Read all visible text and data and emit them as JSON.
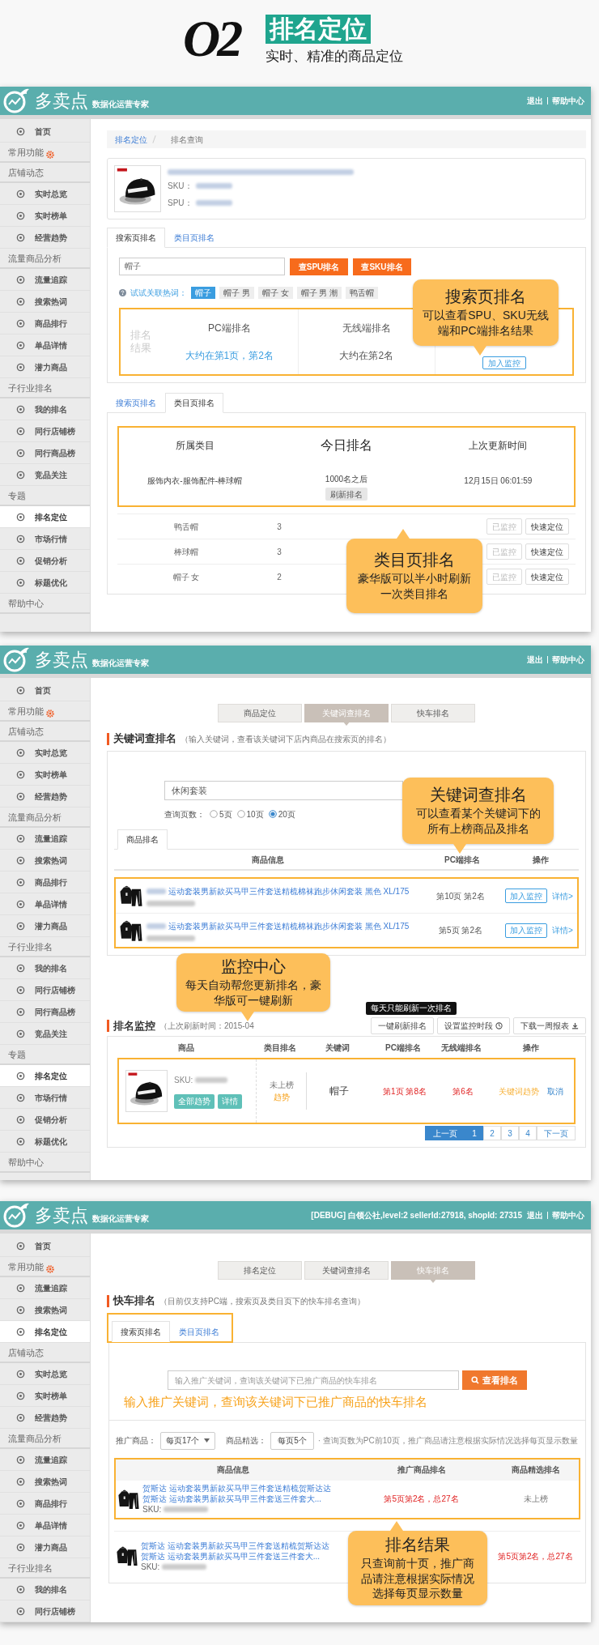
{
  "banner": {
    "number": "O2",
    "title": "排名定位",
    "subtitle": "实时、精准的商品定位"
  },
  "search_ranking_screen": {
    "topbar": {
      "brand": "多卖点",
      "tagline": "数据化运营专家",
      "links": [
        "退出",
        "帮助中心"
      ]
    },
    "sidebar": [
      {
        "kind": "item",
        "label": "首页",
        "selected": false
      },
      {
        "kind": "section",
        "label": "常用功能",
        "gear": true
      },
      {
        "kind": "section",
        "label": "店铺动态"
      },
      {
        "kind": "item",
        "label": "实时总览",
        "selected": false
      },
      {
        "kind": "item",
        "label": "实时榜单",
        "selected": false
      },
      {
        "kind": "item",
        "label": "经营趋势",
        "selected": false
      },
      {
        "kind": "section",
        "label": "流量商品分析"
      },
      {
        "kind": "item",
        "label": "流量追踪",
        "selected": false
      },
      {
        "kind": "item",
        "label": "搜索热词",
        "selected": false
      },
      {
        "kind": "item",
        "label": "商品排行",
        "selected": false
      },
      {
        "kind": "item",
        "label": "单品详情",
        "selected": false
      },
      {
        "kind": "item",
        "label": "潜力商品",
        "selected": false
      },
      {
        "kind": "section",
        "label": "子行业排名"
      },
      {
        "kind": "item",
        "label": "我的排名",
        "selected": false
      },
      {
        "kind": "item",
        "label": "同行店铺榜",
        "selected": false
      },
      {
        "kind": "item",
        "label": "同行商品榜",
        "selected": false
      },
      {
        "kind": "item",
        "label": "竞品关注",
        "selected": false
      },
      {
        "kind": "section",
        "label": "专题"
      },
      {
        "kind": "item",
        "label": "排名定位",
        "selected": true
      },
      {
        "kind": "item",
        "label": "市场行情",
        "selected": false
      },
      {
        "kind": "item",
        "label": "促销分析",
        "selected": false
      },
      {
        "kind": "item",
        "label": "标题优化",
        "selected": false
      },
      {
        "kind": "section",
        "label": "帮助中心"
      }
    ],
    "breadcrumb": [
      "排名定位",
      "排名查询"
    ],
    "product": {
      "sku_label": "SKU：",
      "spu_label": "SPU："
    },
    "tabs": [
      {
        "label": "搜索页排名",
        "selected": true
      },
      {
        "label": "类目页排名",
        "selected": false
      }
    ],
    "search": {
      "value": "帽子",
      "buttons": [
        "查SPU排名",
        "查SKU排名"
      ]
    },
    "hot_words": {
      "label": "试试关联热词：",
      "words": [
        {
          "label": "帽子",
          "selected": true
        },
        {
          "label": "帽子 男",
          "selected": false
        },
        {
          "label": "帽子 女",
          "selected": false
        },
        {
          "label": "帽子 男 潮",
          "selected": false
        },
        {
          "label": "鸭舌帽",
          "selected": false
        }
      ]
    },
    "result": {
      "side_label": "排名结果",
      "columns": [
        {
          "header": "PC端排名",
          "value": "大约在第1页，第2名"
        },
        {
          "header": "无线端排名",
          "value": "大约在第2名"
        }
      ],
      "button": "加入监控"
    },
    "callout": {
      "title": "搜索页排名",
      "text": "可以查看SPU、SKU无线端和PC端排名结果"
    },
    "category_tabs": [
      {
        "label": "搜索页排名",
        "selected": false
      },
      {
        "label": "类目页排名",
        "selected": true
      }
    ],
    "category": {
      "headers": [
        "所属类目",
        "今日排名",
        "上次更新时间"
      ],
      "category": "服饰内衣-服饰配件-棒球帽",
      "rank": "1000名之后",
      "refresh_button": "刷新排名",
      "updated": "12月15日 06:01:59"
    },
    "rows": [
      {
        "cells": [
          "鸭舌帽",
          "3"
        ],
        "buttons": [
          {
            "label": "已监控",
            "disabled": true
          },
          {
            "label": "快速定位",
            "disabled": false
          }
        ]
      },
      {
        "cells": [
          "棒球帽",
          "3"
        ],
        "buttons": [
          {
            "label": "已监控",
            "disabled": true
          },
          {
            "label": "快速定位",
            "disabled": false
          }
        ]
      },
      {
        "cells": [
          "帽子 女",
          "2"
        ],
        "buttons": [
          {
            "label": "已监控",
            "disabled": true
          },
          {
            "label": "快速定位",
            "disabled": false
          }
        ]
      }
    ],
    "callout_2": {
      "title": "类目页排名",
      "text": "豪华版可以半小时刷新一次类目排名"
    }
  },
  "keyword_ranking_screen": {
    "topbar": {
      "brand": "多卖点",
      "tagline": "数据化运营专家",
      "links": [
        "退出",
        "帮助中心"
      ]
    },
    "sidebar": [
      {
        "kind": "item",
        "label": "首页",
        "selected": false
      },
      {
        "kind": "section",
        "label": "常用功能",
        "gear": true
      },
      {
        "kind": "section",
        "label": "店铺动态"
      },
      {
        "kind": "item",
        "label": "实时总览",
        "selected": false
      },
      {
        "kind": "item",
        "label": "实时榜单",
        "selected": false
      },
      {
        "kind": "item",
        "label": "经营趋势",
        "selected": false
      },
      {
        "kind": "section",
        "label": "流量商品分析"
      },
      {
        "kind": "item",
        "label": "流量追踪",
        "selected": false
      },
      {
        "kind": "item",
        "label": "搜索热词",
        "selected": false
      },
      {
        "kind": "item",
        "label": "商品排行",
        "selected": false
      },
      {
        "kind": "item",
        "label": "单品详情",
        "selected": false
      },
      {
        "kind": "item",
        "label": "潜力商品",
        "selected": false
      },
      {
        "kind": "section",
        "label": "子行业排名"
      },
      {
        "kind": "item",
        "label": "我的排名",
        "selected": false
      },
      {
        "kind": "item",
        "label": "同行店铺榜",
        "selected": false
      },
      {
        "kind": "item",
        "label": "同行商品榜",
        "selected": false
      },
      {
        "kind": "item",
        "label": "竞品关注",
        "selected": false
      },
      {
        "kind": "section",
        "label": "专题"
      },
      {
        "kind": "item",
        "label": "排名定位",
        "selected": true
      },
      {
        "kind": "item",
        "label": "市场行情",
        "selected": false
      },
      {
        "kind": "item",
        "label": "促销分析",
        "selected": false
      },
      {
        "kind": "item",
        "label": "标题优化",
        "selected": false
      },
      {
        "kind": "section",
        "label": "帮助中心"
      }
    ],
    "tabs": [
      {
        "label": "商品定位",
        "selected": false
      },
      {
        "label": "关键词查排名",
        "selected": true
      },
      {
        "label": "快车排名",
        "selected": false
      }
    ],
    "section_title": "关键词查排名",
    "section_note": "（输入关键词，查看该关键词下店内商品在搜索页的排名）",
    "search": {
      "value": "休闲套装"
    },
    "pages": {
      "label": "查询页数：",
      "options": [
        {
          "label": "5页",
          "selected": false
        },
        {
          "label": "10页",
          "selected": false
        },
        {
          "label": "20页",
          "selected": true
        }
      ]
    },
    "result_tabs": [
      {
        "label": "商品排名",
        "selected": true
      }
    ],
    "table": {
      "columns": [
        "商品信息",
        "PC端排名",
        "操作"
      ],
      "rows": [
        {
          "title": "运动套装男新款买马甲三件套送精梳棉袜跑步休闲套装 黑色 XL/175",
          "pc_rank": "第10页 第2名",
          "buttons": [
            "加入监控",
            "详情>"
          ]
        },
        {
          "title": "运动套装男新款买马甲三件套送精梳棉袜跑步休闲套装 黑色 XL/175",
          "pc_rank": "第5页 第2名",
          "buttons": [
            "加入监控",
            "详情>"
          ]
        }
      ]
    },
    "callout": {
      "title": "关键词查排名",
      "text": "可以查看某个关键词下的所有上榜商品及排名"
    },
    "monitor": {
      "title": "排名监控",
      "note": "（上次刷新时间：2015-04",
      "tooltip": "每天只能刷新一次排名",
      "buttons": [
        "一键刷新排名",
        "设置监控时段",
        "下载一周报表"
      ],
      "columns": [
        "商品",
        "类目排名",
        "关键词",
        "PC端排名",
        "无线端排名",
        "操作"
      ],
      "row": {
        "sku_label": "SKU:",
        "buttons": [
          "全部趋势",
          "详情"
        ],
        "category_rank": "未上榜",
        "category_trend": "趋势",
        "keyword": "帽子",
        "pc_rank": "第1页 第8名",
        "mobile_rank": "第6名",
        "trend_link": "关键词趋势",
        "cancel": "取消"
      },
      "pagination": {
        "prev": "上一页",
        "pages": [
          {
            "label": "1",
            "selected": true
          },
          {
            "label": "2",
            "selected": false
          },
          {
            "label": "3",
            "selected": false
          },
          {
            "label": "4",
            "selected": false
          }
        ],
        "next": "下一页"
      }
    },
    "callout_2": {
      "title": "监控中心",
      "text": "每天自动帮您更新排名，豪华版可一键刷新"
    }
  },
  "express_ranking_screen": {
    "topbar": {
      "brand": "多卖点",
      "tagline": "数据化运营专家",
      "debug": "[DEBUG] 白领公社,level:2 sellerId:27918, shopId: 27315",
      "links": [
        "退出",
        "帮助中心"
      ]
    },
    "sidebar": [
      {
        "kind": "item",
        "label": "首页",
        "selected": false
      },
      {
        "kind": "section",
        "label": "常用功能",
        "gear": true
      },
      {
        "kind": "item",
        "label": "流量追踪",
        "selected": false
      },
      {
        "kind": "item",
        "label": "搜索热词",
        "selected": false
      },
      {
        "kind": "item",
        "label": "排名定位",
        "selected": true
      },
      {
        "kind": "section",
        "label": "店铺动态"
      },
      {
        "kind": "item",
        "label": "实时总览",
        "selected": false
      },
      {
        "kind": "item",
        "label": "实时榜单",
        "selected": false
      },
      {
        "kind": "item",
        "label": "经营趋势",
        "selected": false
      },
      {
        "kind": "section",
        "label": "流量商品分析"
      },
      {
        "kind": "item",
        "label": "流量追踪",
        "selected": false
      },
      {
        "kind": "item",
        "label": "搜索热词",
        "selected": false
      },
      {
        "kind": "item",
        "label": "商品排行",
        "selected": false
      },
      {
        "kind": "item",
        "label": "单品详情",
        "selected": false
      },
      {
        "kind": "item",
        "label": "潜力商品",
        "selected": false
      },
      {
        "kind": "section",
        "label": "子行业排名"
      },
      {
        "kind": "item",
        "label": "我的排名",
        "selected": false
      },
      {
        "kind": "item",
        "label": "同行店铺榜",
        "selected": false
      }
    ],
    "tabs": [
      {
        "label": "排名定位",
        "selected": false
      },
      {
        "label": "关键词查排名",
        "selected": false
      },
      {
        "label": "快车排名",
        "selected": true
      }
    ],
    "section_title": "快车排名",
    "section_note": "（目前仅支持PC端，搜索页及类目页下的快车排名查询）",
    "sub_tabs": [
      {
        "label": "搜索页排名",
        "selected": true
      },
      {
        "label": "类目页排名",
        "selected": false
      }
    ],
    "search": {
      "placeholder": "输入推广关键词，查询该关键词下已推广商品的快车排名",
      "button": "查看排名"
    },
    "annotation": "输入推广关键词，查询该关键词下已推广商品的快车排名",
    "filters": [
      {
        "label": "推广商品：",
        "value": "每页17个",
        "kind": "dropdown"
      },
      {
        "label": "商品精选：",
        "value": "每页5个",
        "kind": "field"
      }
    ],
    "filter_note": "· 查询页数为PC前10页，推广商品请注意根据实际情况选择每页显示数量",
    "table": {
      "columns": [
        "商品信息",
        "推广商品排名",
        "商品精选排名"
      ],
      "rows": [
        {
          "title_lines": [
            "贺斯达 运动套装男新款买马甲三件套送精梳贺斯达达",
            "贺斯达 运动套装男新款买马甲三件套送三件套大..."
          ],
          "sku_label": "SKU:",
          "promo_rank": {
            "text": "第5页第2名，总27名",
            "ranked": true
          },
          "featured_rank": {
            "text": "未上榜",
            "ranked": false
          }
        },
        {
          "title_lines": [
            "贺斯达 运动套装男新款买马甲三件套送精梳贺斯达达",
            "贺斯达 运动套装男新款买马甲三件套送三件套大..."
          ],
          "sku_label": "SKU:",
          "featured_rank": {
            "text": "第5页第2名，总27名",
            "ranked": true
          }
        }
      ]
    },
    "callout": {
      "title": "排名结果",
      "text": "只查询前十页，推广商品请注意根据实际情况选择每页显示数量"
    }
  }
}
